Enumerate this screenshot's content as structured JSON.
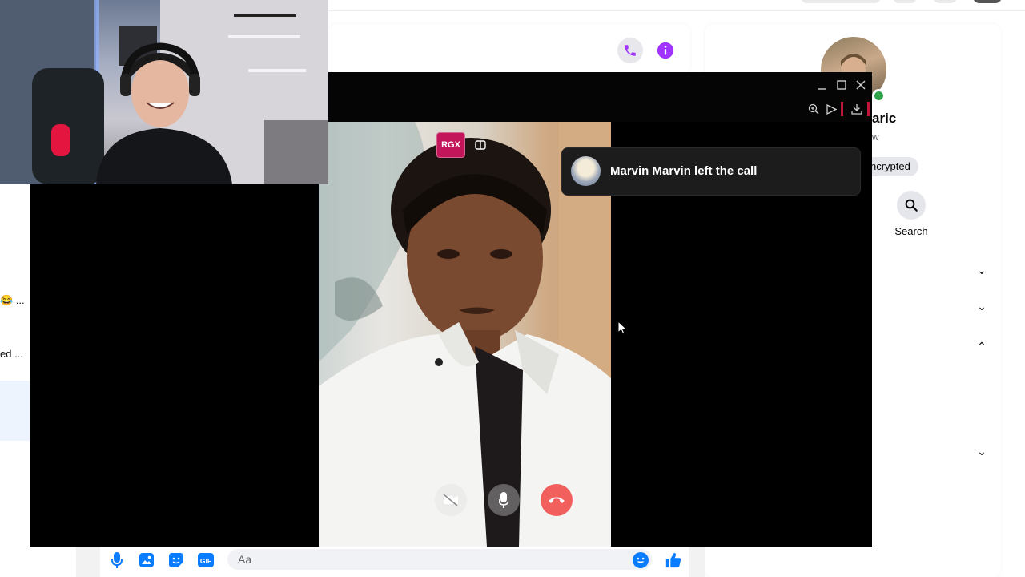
{
  "chat": {
    "snippet_1": "😂 ...",
    "snippet_2": "ed ...",
    "composer_placeholder": "Aa"
  },
  "profile": {
    "name_partial": "aric",
    "status_partial": "w",
    "encrypted_label": "ncrypted",
    "search_label": "Search"
  },
  "call": {
    "toast_message": "Marvin Marvin left the call",
    "badge_label": "RGX"
  },
  "colors": {
    "messenger_accent": "#a033ff",
    "like_blue": "#0a7cff",
    "end_call_red": "#f1605d",
    "online_green": "#31a24c"
  },
  "icons": {
    "header": [
      "phone-icon",
      "info-icon"
    ],
    "window": [
      "minimize-icon",
      "maximize-icon",
      "close-icon"
    ],
    "toolbar": [
      "zoom-in-icon",
      "send-icon",
      "download-icon"
    ],
    "call_controls": [
      "camera-off-icon",
      "microphone-icon",
      "end-call-icon"
    ],
    "composer": [
      "microphone-icon",
      "image-icon",
      "sticker-icon",
      "gif-icon",
      "emoji-icon",
      "like-icon"
    ]
  }
}
